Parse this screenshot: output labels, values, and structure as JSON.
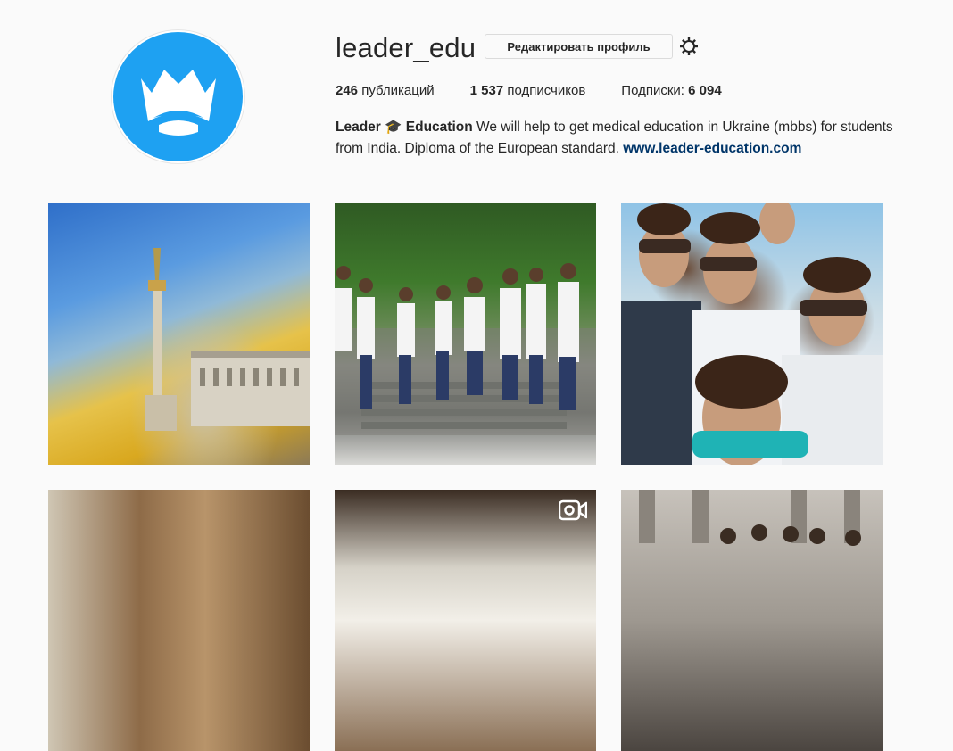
{
  "profile": {
    "username": "leader_edu",
    "edit_button_label": "Редактировать профиль",
    "avatar_icon": "crown-logo",
    "avatar_color": "#1ea1f2",
    "settings_icon": "gear-icon"
  },
  "stats": {
    "posts_count": "246",
    "posts_label": " публикаций",
    "followers_count": "1 537",
    "followers_label": " подписчиков",
    "following_label": "Подписки: ",
    "following_count": "6 094"
  },
  "bio": {
    "name_part1": "Leader",
    "emoji": "🎓",
    "name_part2": "Education",
    "text": " We will help to get medical education in Ukraine (mbbs) for students from India. Diploma of the European standard. ",
    "link": "www.leader-education.com"
  },
  "grid": {
    "posts": [
      {
        "kind": "photo",
        "subject": "kyiv-independence-monument-flag"
      },
      {
        "kind": "photo",
        "subject": "students-in-white-coats-on-stairs"
      },
      {
        "kind": "photo",
        "subject": "group-selfie-sunglasses"
      },
      {
        "kind": "photo",
        "subject": "ornate-interior"
      },
      {
        "kind": "video",
        "subject": "skylight-interior",
        "badge_icon": "video-icon"
      },
      {
        "kind": "photo",
        "subject": "group-in-front-of-building"
      }
    ]
  },
  "colors": {
    "link": "#003569",
    "background": "#fafafa"
  }
}
